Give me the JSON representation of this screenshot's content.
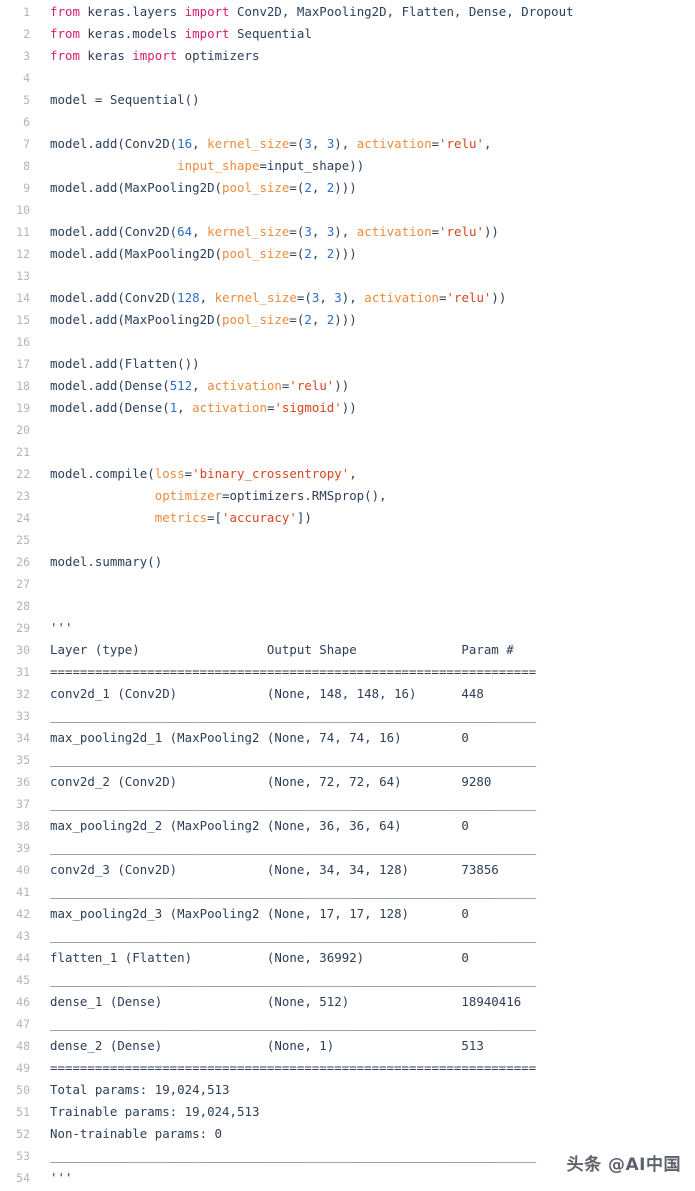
{
  "editor": {
    "title": "Keras CNN model definition code",
    "language": "python",
    "first_line_number": 1,
    "total_lines": 54,
    "colors": {
      "background": "#ffffff",
      "text": "#2d3e57",
      "line_number": "#b4b4b4",
      "keyword": "#d61c6e",
      "number": "#2a6ec6",
      "keyword_argument": "#ec8b3c",
      "string": "#d8461d"
    }
  },
  "watermark": {
    "text": "头条 @AI中国"
  },
  "lines": [
    {
      "n": "1",
      "tokens": [
        {
          "t": "from ",
          "c": "kw"
        },
        {
          "t": "keras.layers ",
          "c": "plain"
        },
        {
          "t": "import ",
          "c": "kw"
        },
        {
          "t": "Conv2D, MaxPooling2D, Flatten, Dense, Dropout",
          "c": "plain"
        }
      ]
    },
    {
      "n": "2",
      "tokens": [
        {
          "t": "from ",
          "c": "kw"
        },
        {
          "t": "keras.models ",
          "c": "plain"
        },
        {
          "t": "import ",
          "c": "kw"
        },
        {
          "t": "Sequential",
          "c": "plain"
        }
      ]
    },
    {
      "n": "3",
      "tokens": [
        {
          "t": "from ",
          "c": "kw"
        },
        {
          "t": "keras ",
          "c": "plain"
        },
        {
          "t": "import ",
          "c": "kw"
        },
        {
          "t": "optimizers",
          "c": "plain"
        }
      ]
    },
    {
      "n": "4",
      "tokens": []
    },
    {
      "n": "5",
      "tokens": [
        {
          "t": "model = Sequential()",
          "c": "plain"
        }
      ]
    },
    {
      "n": "6",
      "tokens": []
    },
    {
      "n": "7",
      "tokens": [
        {
          "t": "model.add(Conv2D(",
          "c": "plain"
        },
        {
          "t": "16",
          "c": "num"
        },
        {
          "t": ", ",
          "c": "plain"
        },
        {
          "t": "kernel_size",
          "c": "kwarg"
        },
        {
          "t": "=(",
          "c": "plain"
        },
        {
          "t": "3",
          "c": "num"
        },
        {
          "t": ", ",
          "c": "plain"
        },
        {
          "t": "3",
          "c": "num"
        },
        {
          "t": "), ",
          "c": "plain"
        },
        {
          "t": "activation",
          "c": "kwarg"
        },
        {
          "t": "=",
          "c": "plain"
        },
        {
          "t": "'relu'",
          "c": "str"
        },
        {
          "t": ",",
          "c": "plain"
        }
      ]
    },
    {
      "n": "8",
      "tokens": [
        {
          "t": "                 ",
          "c": "plain"
        },
        {
          "t": "input_shape",
          "c": "kwarg"
        },
        {
          "t": "=input_shape))",
          "c": "plain"
        }
      ]
    },
    {
      "n": "9",
      "tokens": [
        {
          "t": "model.add(MaxPooling2D(",
          "c": "plain"
        },
        {
          "t": "pool_size",
          "c": "kwarg"
        },
        {
          "t": "=(",
          "c": "plain"
        },
        {
          "t": "2",
          "c": "num"
        },
        {
          "t": ", ",
          "c": "plain"
        },
        {
          "t": "2",
          "c": "num"
        },
        {
          "t": ")))",
          "c": "plain"
        }
      ]
    },
    {
      "n": "10",
      "tokens": []
    },
    {
      "n": "11",
      "tokens": [
        {
          "t": "model.add(Conv2D(",
          "c": "plain"
        },
        {
          "t": "64",
          "c": "num"
        },
        {
          "t": ", ",
          "c": "plain"
        },
        {
          "t": "kernel_size",
          "c": "kwarg"
        },
        {
          "t": "=(",
          "c": "plain"
        },
        {
          "t": "3",
          "c": "num"
        },
        {
          "t": ", ",
          "c": "plain"
        },
        {
          "t": "3",
          "c": "num"
        },
        {
          "t": "), ",
          "c": "plain"
        },
        {
          "t": "activation",
          "c": "kwarg"
        },
        {
          "t": "=",
          "c": "plain"
        },
        {
          "t": "'relu'",
          "c": "str"
        },
        {
          "t": "))",
          "c": "plain"
        }
      ]
    },
    {
      "n": "12",
      "tokens": [
        {
          "t": "model.add(MaxPooling2D(",
          "c": "plain"
        },
        {
          "t": "pool_size",
          "c": "kwarg"
        },
        {
          "t": "=(",
          "c": "plain"
        },
        {
          "t": "2",
          "c": "num"
        },
        {
          "t": ", ",
          "c": "plain"
        },
        {
          "t": "2",
          "c": "num"
        },
        {
          "t": ")))",
          "c": "plain"
        }
      ]
    },
    {
      "n": "13",
      "tokens": []
    },
    {
      "n": "14",
      "tokens": [
        {
          "t": "model.add(Conv2D(",
          "c": "plain"
        },
        {
          "t": "128",
          "c": "num"
        },
        {
          "t": ", ",
          "c": "plain"
        },
        {
          "t": "kernel_size",
          "c": "kwarg"
        },
        {
          "t": "=(",
          "c": "plain"
        },
        {
          "t": "3",
          "c": "num"
        },
        {
          "t": ", ",
          "c": "plain"
        },
        {
          "t": "3",
          "c": "num"
        },
        {
          "t": "), ",
          "c": "plain"
        },
        {
          "t": "activation",
          "c": "kwarg"
        },
        {
          "t": "=",
          "c": "plain"
        },
        {
          "t": "'relu'",
          "c": "str"
        },
        {
          "t": "))",
          "c": "plain"
        }
      ]
    },
    {
      "n": "15",
      "tokens": [
        {
          "t": "model.add(MaxPooling2D(",
          "c": "plain"
        },
        {
          "t": "pool_size",
          "c": "kwarg"
        },
        {
          "t": "=(",
          "c": "plain"
        },
        {
          "t": "2",
          "c": "num"
        },
        {
          "t": ", ",
          "c": "plain"
        },
        {
          "t": "2",
          "c": "num"
        },
        {
          "t": ")))",
          "c": "plain"
        }
      ]
    },
    {
      "n": "16",
      "tokens": []
    },
    {
      "n": "17",
      "tokens": [
        {
          "t": "model.add(Flatten())",
          "c": "plain"
        }
      ]
    },
    {
      "n": "18",
      "tokens": [
        {
          "t": "model.add(Dense(",
          "c": "plain"
        },
        {
          "t": "512",
          "c": "num"
        },
        {
          "t": ", ",
          "c": "plain"
        },
        {
          "t": "activation",
          "c": "kwarg"
        },
        {
          "t": "=",
          "c": "plain"
        },
        {
          "t": "'relu'",
          "c": "str"
        },
        {
          "t": "))",
          "c": "plain"
        }
      ]
    },
    {
      "n": "19",
      "tokens": [
        {
          "t": "model.add(Dense(",
          "c": "plain"
        },
        {
          "t": "1",
          "c": "num"
        },
        {
          "t": ", ",
          "c": "plain"
        },
        {
          "t": "activation",
          "c": "kwarg"
        },
        {
          "t": "=",
          "c": "plain"
        },
        {
          "t": "'sigmoid'",
          "c": "str"
        },
        {
          "t": "))",
          "c": "plain"
        }
      ]
    },
    {
      "n": "20",
      "tokens": []
    },
    {
      "n": "21",
      "tokens": []
    },
    {
      "n": "22",
      "tokens": [
        {
          "t": "model.compile(",
          "c": "plain"
        },
        {
          "t": "loss",
          "c": "kwarg"
        },
        {
          "t": "=",
          "c": "plain"
        },
        {
          "t": "'binary_crossentropy'",
          "c": "str"
        },
        {
          "t": ",",
          "c": "plain"
        }
      ]
    },
    {
      "n": "23",
      "tokens": [
        {
          "t": "              ",
          "c": "plain"
        },
        {
          "t": "optimizer",
          "c": "kwarg"
        },
        {
          "t": "=optimizers.RMSprop(),",
          "c": "plain"
        }
      ]
    },
    {
      "n": "24",
      "tokens": [
        {
          "t": "              ",
          "c": "plain"
        },
        {
          "t": "metrics",
          "c": "kwarg"
        },
        {
          "t": "=[",
          "c": "plain"
        },
        {
          "t": "'accuracy'",
          "c": "str"
        },
        {
          "t": "])",
          "c": "plain"
        }
      ]
    },
    {
      "n": "25",
      "tokens": []
    },
    {
      "n": "26",
      "tokens": [
        {
          "t": "model.summary()",
          "c": "plain"
        }
      ]
    },
    {
      "n": "27",
      "tokens": []
    },
    {
      "n": "28",
      "tokens": []
    },
    {
      "n": "29",
      "tokens": [
        {
          "t": "'''",
          "c": "txt"
        }
      ]
    },
    {
      "n": "30",
      "tokens": [
        {
          "t": "Layer (type)                 Output Shape              Param #",
          "c": "txt"
        }
      ]
    },
    {
      "n": "31",
      "tokens": [
        {
          "t": "=================================================================",
          "c": "txt"
        }
      ]
    },
    {
      "n": "32",
      "tokens": [
        {
          "t": "conv2d_1 (Conv2D)            (None, 148, 148, 16)      448",
          "c": "txt"
        }
      ]
    },
    {
      "n": "33",
      "tokens": [
        {
          "t": "_________________________________________________________________",
          "c": "txt"
        }
      ]
    },
    {
      "n": "34",
      "tokens": [
        {
          "t": "max_pooling2d_1 (MaxPooling2 (None, 74, 74, 16)        0",
          "c": "txt"
        }
      ]
    },
    {
      "n": "35",
      "tokens": [
        {
          "t": "_________________________________________________________________",
          "c": "txt"
        }
      ]
    },
    {
      "n": "36",
      "tokens": [
        {
          "t": "conv2d_2 (Conv2D)            (None, 72, 72, 64)        9280",
          "c": "txt"
        }
      ]
    },
    {
      "n": "37",
      "tokens": [
        {
          "t": "_________________________________________________________________",
          "c": "txt"
        }
      ]
    },
    {
      "n": "38",
      "tokens": [
        {
          "t": "max_pooling2d_2 (MaxPooling2 (None, 36, 36, 64)        0",
          "c": "txt"
        }
      ]
    },
    {
      "n": "39",
      "tokens": [
        {
          "t": "_________________________________________________________________",
          "c": "txt"
        }
      ]
    },
    {
      "n": "40",
      "tokens": [
        {
          "t": "conv2d_3 (Conv2D)            (None, 34, 34, 128)       73856",
          "c": "txt"
        }
      ]
    },
    {
      "n": "41",
      "tokens": [
        {
          "t": "_________________________________________________________________",
          "c": "txt"
        }
      ]
    },
    {
      "n": "42",
      "tokens": [
        {
          "t": "max_pooling2d_3 (MaxPooling2 (None, 17, 17, 128)       0",
          "c": "txt"
        }
      ]
    },
    {
      "n": "43",
      "tokens": [
        {
          "t": "_________________________________________________________________",
          "c": "txt"
        }
      ]
    },
    {
      "n": "44",
      "tokens": [
        {
          "t": "flatten_1 (Flatten)          (None, 36992)             0",
          "c": "txt"
        }
      ]
    },
    {
      "n": "45",
      "tokens": [
        {
          "t": "_________________________________________________________________",
          "c": "txt"
        }
      ]
    },
    {
      "n": "46",
      "tokens": [
        {
          "t": "dense_1 (Dense)              (None, 512)               18940416",
          "c": "txt"
        }
      ]
    },
    {
      "n": "47",
      "tokens": [
        {
          "t": "_________________________________________________________________",
          "c": "txt"
        }
      ]
    },
    {
      "n": "48",
      "tokens": [
        {
          "t": "dense_2 (Dense)              (None, 1)                 513",
          "c": "txt"
        }
      ]
    },
    {
      "n": "49",
      "tokens": [
        {
          "t": "=================================================================",
          "c": "txt"
        }
      ]
    },
    {
      "n": "50",
      "tokens": [
        {
          "t": "Total params: 19,024,513",
          "c": "txt"
        }
      ]
    },
    {
      "n": "51",
      "tokens": [
        {
          "t": "Trainable params: 19,024,513",
          "c": "txt"
        }
      ]
    },
    {
      "n": "52",
      "tokens": [
        {
          "t": "Non-trainable params: 0",
          "c": "txt"
        }
      ]
    },
    {
      "n": "53",
      "tokens": [
        {
          "t": "_________________________________________________________________",
          "c": "txt"
        }
      ]
    },
    {
      "n": "54",
      "tokens": [
        {
          "t": "'''",
          "c": "txt"
        }
      ]
    }
  ],
  "model_summary": {
    "columns": [
      "Layer (type)",
      "Output Shape",
      "Param #"
    ],
    "rows": [
      {
        "layer": "conv2d_1 (Conv2D)",
        "output_shape": "(None, 148, 148, 16)",
        "params": "448"
      },
      {
        "layer": "max_pooling2d_1 (MaxPooling2",
        "output_shape": "(None, 74, 74, 16)",
        "params": "0"
      },
      {
        "layer": "conv2d_2 (Conv2D)",
        "output_shape": "(None, 72, 72, 64)",
        "params": "9280"
      },
      {
        "layer": "max_pooling2d_2 (MaxPooling2",
        "output_shape": "(None, 36, 36, 64)",
        "params": "0"
      },
      {
        "layer": "conv2d_3 (Conv2D)",
        "output_shape": "(None, 34, 34, 128)",
        "params": "73856"
      },
      {
        "layer": "max_pooling2d_3 (MaxPooling2",
        "output_shape": "(None, 17, 17, 128)",
        "params": "0"
      },
      {
        "layer": "flatten_1 (Flatten)",
        "output_shape": "(None, 36992)",
        "params": "0"
      },
      {
        "layer": "dense_1 (Dense)",
        "output_shape": "(None, 512)",
        "params": "18940416"
      },
      {
        "layer": "dense_2 (Dense)",
        "output_shape": "(None, 1)",
        "params": "513"
      }
    ],
    "totals": {
      "total_params": "Total params: 19,024,513",
      "trainable_params": "Trainable params: 19,024,513",
      "non_trainable_params": "Non-trainable params: 0"
    }
  }
}
